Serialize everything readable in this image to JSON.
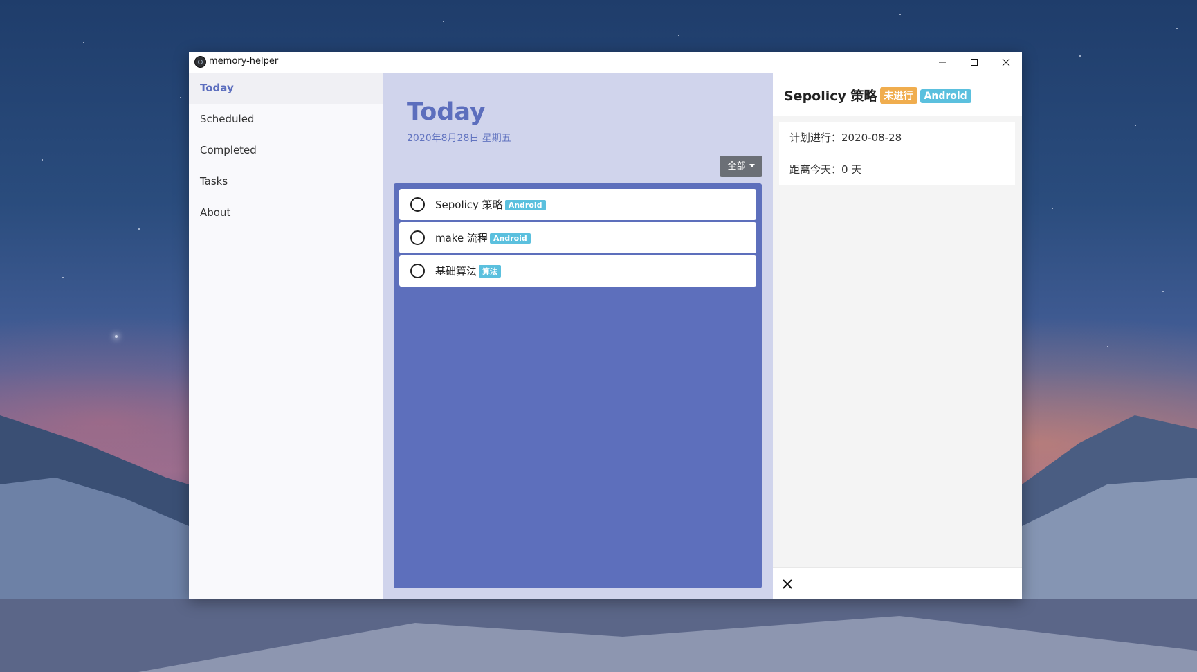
{
  "window": {
    "title": "memory-helper"
  },
  "sidebar": {
    "items": [
      {
        "label": "Today",
        "active": true
      },
      {
        "label": "Scheduled",
        "active": false
      },
      {
        "label": "Completed",
        "active": false
      },
      {
        "label": "Tasks",
        "active": false
      },
      {
        "label": "About",
        "active": false
      }
    ]
  },
  "main": {
    "title": "Today",
    "date": "2020年8月28日 星期五",
    "filter": {
      "selected": "全部"
    },
    "tasks": [
      {
        "name": "Sepolicy 策略",
        "tag": "Android",
        "done": false
      },
      {
        "name": "make 流程",
        "tag": "Android",
        "done": false
      },
      {
        "name": "基础算法",
        "tag": "算法",
        "done": false
      }
    ]
  },
  "detail": {
    "title": "Sepolicy 策略",
    "status_badge": "未进行",
    "tag_badge": "Android",
    "planned": "计划进行：2020-08-28",
    "days_left": "距离今天：0 天"
  },
  "colors": {
    "accent": "#5c6ebe",
    "panel": "#5d6fbc",
    "main_bg": "#d0d4ec",
    "tag": "#5bc0de",
    "status": "#f0ad4e"
  },
  "icons": {
    "app": "app-logo-icon",
    "minimize": "minimize-icon",
    "maximize": "maximize-icon",
    "close": "close-icon",
    "task_check": "circle-checkbox-icon",
    "filter_caret": "caret-down-icon"
  }
}
